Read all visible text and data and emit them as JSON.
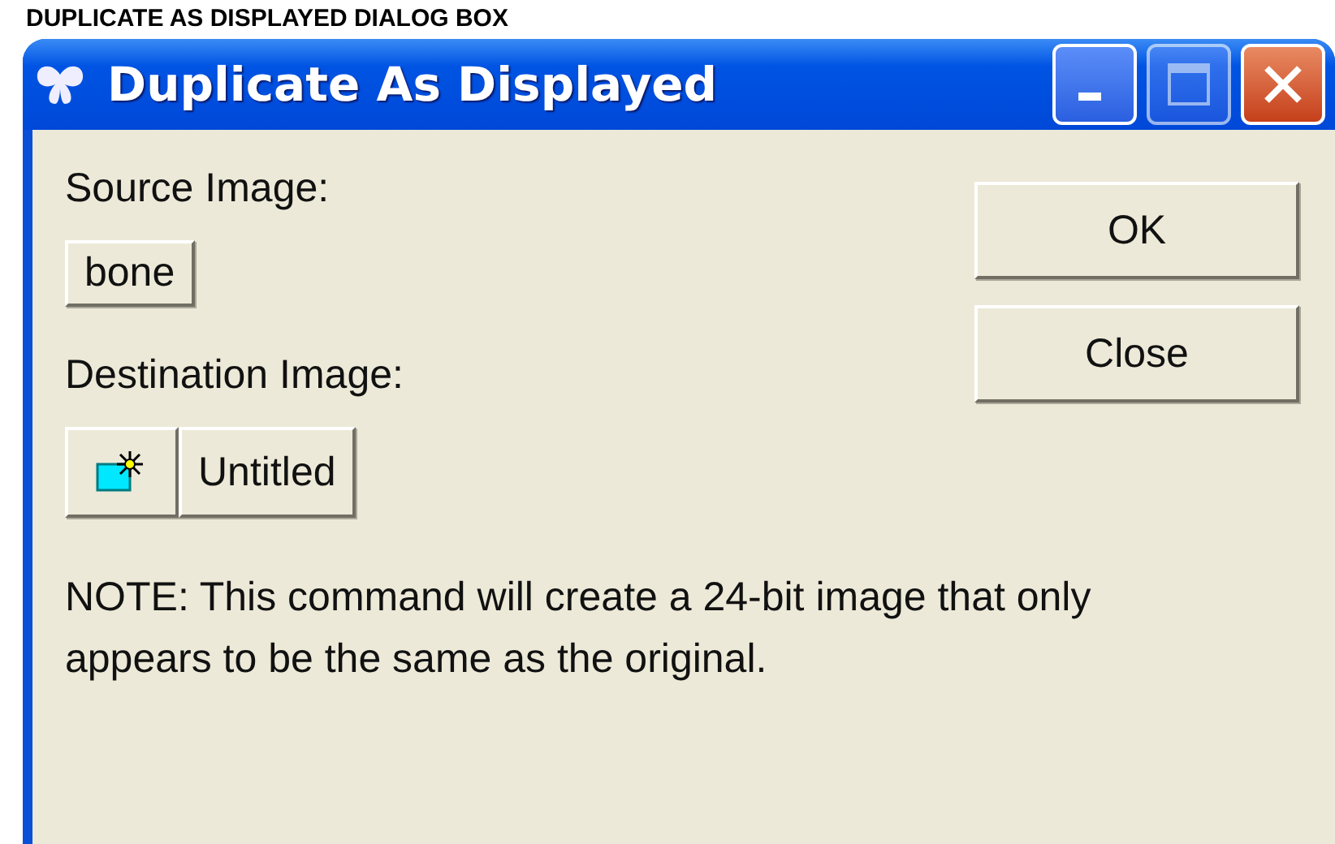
{
  "caption": "DUPLICATE AS DISPLAYED DIALOG BOX",
  "window": {
    "title": "Duplicate As Displayed"
  },
  "source": {
    "label": "Source Image:",
    "button": "bone"
  },
  "destination": {
    "label": "Destination Image:",
    "button": "Untitled"
  },
  "buttons": [
    "OK",
    "Close"
  ],
  "note": "NOTE: This command will create a 24-bit image that only appears to be the same as the original."
}
